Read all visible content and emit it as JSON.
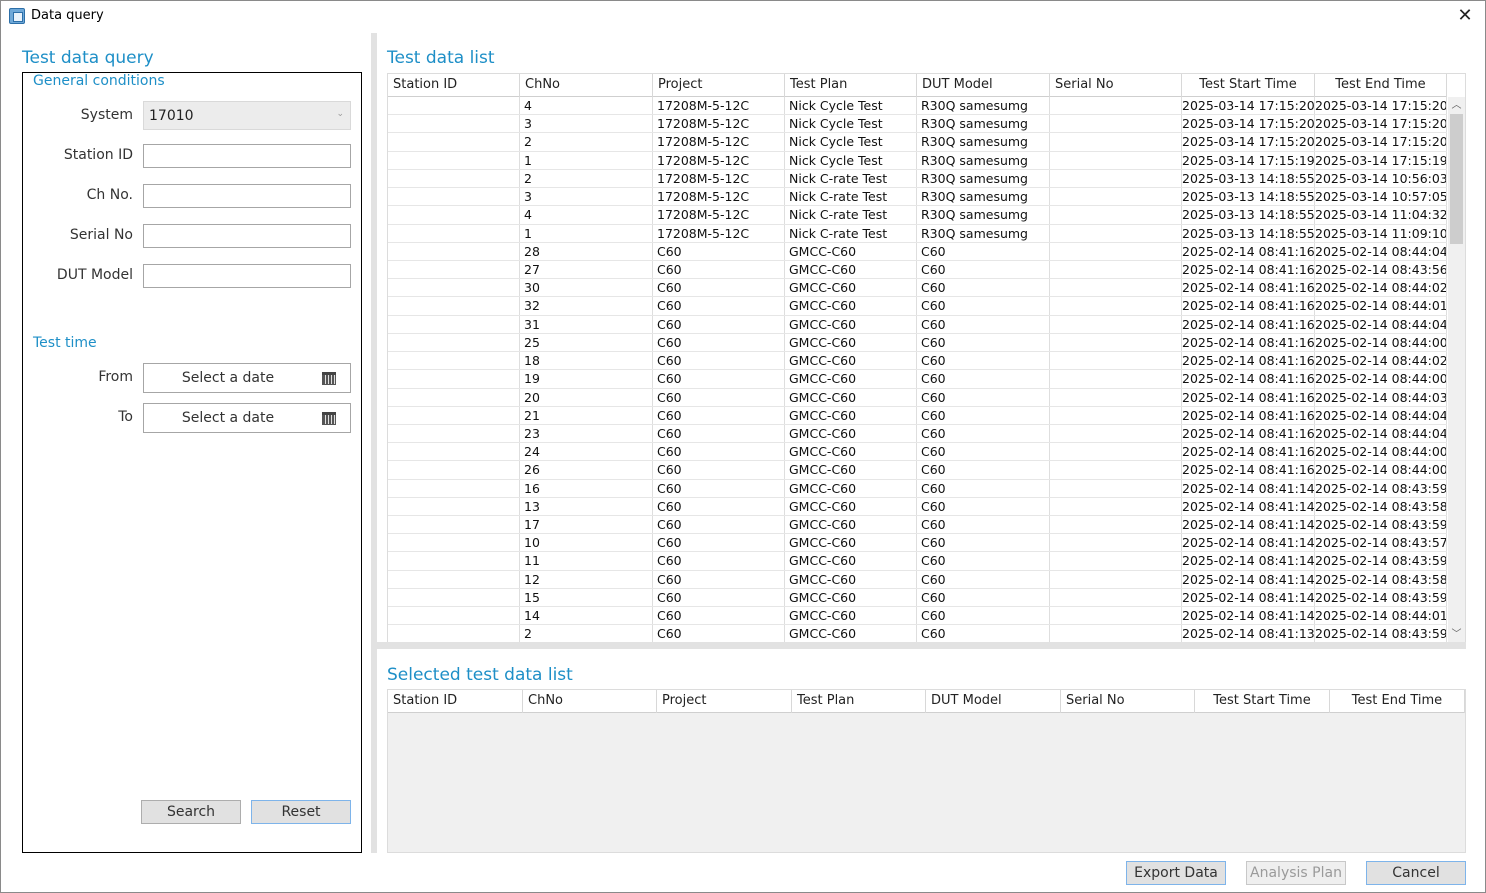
{
  "window": {
    "title": "Data query",
    "close_glyph": "✕"
  },
  "query_panel": {
    "title": "Test data query",
    "general_conditions": {
      "title": "General conditions",
      "system_label": "System",
      "system_value": "17010",
      "station_label": "Station ID",
      "chno_label": "Ch No.",
      "serial_label": "Serial No",
      "dut_label": "DUT Model"
    },
    "test_time": {
      "title": "Test time",
      "from_label": "From",
      "to_label": "To",
      "from_placeholder": "Select a date",
      "to_placeholder": "Select a date"
    },
    "search_label": "Search",
    "reset_label": "Reset"
  },
  "list": {
    "title": "Test data list",
    "columns": [
      "Station ID",
      "ChNo",
      "Project",
      "Test Plan",
      "DUT Model",
      "Serial No",
      "Test Start Time",
      "Test End Time"
    ],
    "rows": [
      [
        "",
        "4",
        "17208M-5-12C",
        "Nick Cycle Test",
        "R30Q samesumg",
        "",
        "2025-03-14 17:15:20",
        "2025-03-14 17:15:20"
      ],
      [
        "",
        "3",
        "17208M-5-12C",
        "Nick Cycle Test",
        "R30Q samesumg",
        "",
        "2025-03-14 17:15:20",
        "2025-03-14 17:15:20"
      ],
      [
        "",
        "2",
        "17208M-5-12C",
        "Nick Cycle Test",
        "R30Q samesumg",
        "",
        "2025-03-14 17:15:20",
        "2025-03-14 17:15:20"
      ],
      [
        "",
        "1",
        "17208M-5-12C",
        "Nick Cycle Test",
        "R30Q samesumg",
        "",
        "2025-03-14 17:15:19",
        "2025-03-14 17:15:19"
      ],
      [
        "",
        "2",
        "17208M-5-12C",
        "Nick C-rate Test",
        "R30Q samesumg",
        "",
        "2025-03-13 14:18:55",
        "2025-03-14 10:56:03"
      ],
      [
        "",
        "3",
        "17208M-5-12C",
        "Nick C-rate Test",
        "R30Q samesumg",
        "",
        "2025-03-13 14:18:55",
        "2025-03-14 10:57:05"
      ],
      [
        "",
        "4",
        "17208M-5-12C",
        "Nick C-rate Test",
        "R30Q samesumg",
        "",
        "2025-03-13 14:18:55",
        "2025-03-14 11:04:32"
      ],
      [
        "",
        "1",
        "17208M-5-12C",
        "Nick C-rate Test",
        "R30Q samesumg",
        "",
        "2025-03-13 14:18:55",
        "2025-03-14 11:09:10"
      ],
      [
        "",
        "28",
        "C60",
        "GMCC-C60",
        "C60",
        "",
        "2025-02-14 08:41:16",
        "2025-02-14 08:44:04"
      ],
      [
        "",
        "27",
        "C60",
        "GMCC-C60",
        "C60",
        "",
        "2025-02-14 08:41:16",
        "2025-02-14 08:43:56"
      ],
      [
        "",
        "30",
        "C60",
        "GMCC-C60",
        "C60",
        "",
        "2025-02-14 08:41:16",
        "2025-02-14 08:44:02"
      ],
      [
        "",
        "32",
        "C60",
        "GMCC-C60",
        "C60",
        "",
        "2025-02-14 08:41:16",
        "2025-02-14 08:44:01"
      ],
      [
        "",
        "31",
        "C60",
        "GMCC-C60",
        "C60",
        "",
        "2025-02-14 08:41:16",
        "2025-02-14 08:44:04"
      ],
      [
        "",
        "25",
        "C60",
        "GMCC-C60",
        "C60",
        "",
        "2025-02-14 08:41:16",
        "2025-02-14 08:44:00"
      ],
      [
        "",
        "18",
        "C60",
        "GMCC-C60",
        "C60",
        "",
        "2025-02-14 08:41:16",
        "2025-02-14 08:44:02"
      ],
      [
        "",
        "19",
        "C60",
        "GMCC-C60",
        "C60",
        "",
        "2025-02-14 08:41:16",
        "2025-02-14 08:44:00"
      ],
      [
        "",
        "20",
        "C60",
        "GMCC-C60",
        "C60",
        "",
        "2025-02-14 08:41:16",
        "2025-02-14 08:44:03"
      ],
      [
        "",
        "21",
        "C60",
        "GMCC-C60",
        "C60",
        "",
        "2025-02-14 08:41:16",
        "2025-02-14 08:44:04"
      ],
      [
        "",
        "23",
        "C60",
        "GMCC-C60",
        "C60",
        "",
        "2025-02-14 08:41:16",
        "2025-02-14 08:44:04"
      ],
      [
        "",
        "24",
        "C60",
        "GMCC-C60",
        "C60",
        "",
        "2025-02-14 08:41:16",
        "2025-02-14 08:44:00"
      ],
      [
        "",
        "26",
        "C60",
        "GMCC-C60",
        "C60",
        "",
        "2025-02-14 08:41:16",
        "2025-02-14 08:44:00"
      ],
      [
        "",
        "16",
        "C60",
        "GMCC-C60",
        "C60",
        "",
        "2025-02-14 08:41:14",
        "2025-02-14 08:43:59"
      ],
      [
        "",
        "13",
        "C60",
        "GMCC-C60",
        "C60",
        "",
        "2025-02-14 08:41:14",
        "2025-02-14 08:43:58"
      ],
      [
        "",
        "17",
        "C60",
        "GMCC-C60",
        "C60",
        "",
        "2025-02-14 08:41:14",
        "2025-02-14 08:43:59"
      ],
      [
        "",
        "10",
        "C60",
        "GMCC-C60",
        "C60",
        "",
        "2025-02-14 08:41:14",
        "2025-02-14 08:43:57"
      ],
      [
        "",
        "11",
        "C60",
        "GMCC-C60",
        "C60",
        "",
        "2025-02-14 08:41:14",
        "2025-02-14 08:43:59"
      ],
      [
        "",
        "12",
        "C60",
        "GMCC-C60",
        "C60",
        "",
        "2025-02-14 08:41:14",
        "2025-02-14 08:43:58"
      ],
      [
        "",
        "15",
        "C60",
        "GMCC-C60",
        "C60",
        "",
        "2025-02-14 08:41:14",
        "2025-02-14 08:43:59"
      ],
      [
        "",
        "14",
        "C60",
        "GMCC-C60",
        "C60",
        "",
        "2025-02-14 08:41:14",
        "2025-02-14 08:44:01"
      ],
      [
        "",
        "2",
        "C60",
        "GMCC-C60",
        "C60",
        "",
        "2025-02-14 08:41:13",
        "2025-02-14 08:43:59"
      ]
    ],
    "scroll_up_glyph": "︿",
    "scroll_down_glyph": "﹀"
  },
  "selected": {
    "title": "Selected test data list",
    "columns": [
      "Station ID",
      "ChNo",
      "Project",
      "Test Plan",
      "DUT Model",
      "Serial No",
      "Test Start Time",
      "Test End Time"
    ]
  },
  "footer": {
    "export_label": "Export Data",
    "analysis_label": "Analysis Plan",
    "cancel_label": "Cancel"
  }
}
